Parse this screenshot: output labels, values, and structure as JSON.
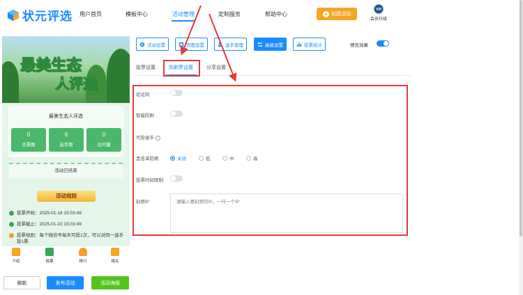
{
  "logo": {
    "text": "状元评选"
  },
  "nav": {
    "items": [
      {
        "label": "用户首页"
      },
      {
        "label": "模板中心"
      },
      {
        "label": "活动管理"
      },
      {
        "label": "定制服务"
      },
      {
        "label": "帮助中心"
      }
    ],
    "active_index": 2,
    "create_label": "创建活动",
    "vip_badge": "VIP",
    "vip_label": "会员升级"
  },
  "preview": {
    "banner_line1": "最美生态",
    "banner_line2": "人评选",
    "card_title": "最美生态人评选",
    "stats": [
      {
        "value": "0",
        "label": "总票数"
      },
      {
        "value": "6",
        "label": "选手数"
      },
      {
        "value": "0",
        "label": "访问量"
      }
    ],
    "status": "活动已结束",
    "rules_title": "活动规则",
    "rules": [
      {
        "text": "投票开始：2025-01-16 15:03:49"
      },
      {
        "text": "投票截止：2025-01-22 15:03:49"
      },
      {
        "text": "投票规则：每个微信号每天可投1次，可以对同一选手投1票"
      }
    ],
    "tabs": [
      {
        "label": "介绍"
      },
      {
        "label": "投票"
      },
      {
        "label": "排行"
      },
      {
        "label": "报名"
      }
    ]
  },
  "actions": {
    "refresh": "刷新",
    "publish": "发布活动",
    "poster": "活动海报"
  },
  "toolbar": {
    "buttons": [
      {
        "label": "活动设置"
      },
      {
        "label": "页面设置"
      },
      {
        "label": "选手管理"
      },
      {
        "label": "高级设置"
      },
      {
        "label": "投票统计"
      }
    ],
    "active_index": 3,
    "preview_label": "预览效果",
    "preview_on": true
  },
  "subtabs": {
    "items": [
      {
        "label": "投票设置"
      },
      {
        "label": "防刷票设置"
      },
      {
        "label": "分享设置"
      }
    ],
    "active_index": 1
  },
  "form": {
    "captcha_label": "验证码",
    "captcha_on": false,
    "smart_label": "智能防刷",
    "smart_on": false,
    "region_label": "可投省市",
    "blacklist_label": "黑名单防刷",
    "blacklist_options": [
      {
        "label": "关闭"
      },
      {
        "label": "低"
      },
      {
        "label": "中"
      },
      {
        "label": "高"
      }
    ],
    "blacklist_selected": "关闭",
    "time_limit_label": "投票时间限制",
    "time_limit_on": false,
    "block_ip_label": "封禁IP",
    "block_ip_placeholder": "请输入要封禁的IP，一行一个IP",
    "block_ip_value": ""
  },
  "colors": {
    "primary": "#1a8cff",
    "orange": "#f5a623",
    "green": "#52c41a",
    "annotation": "#e53935"
  }
}
